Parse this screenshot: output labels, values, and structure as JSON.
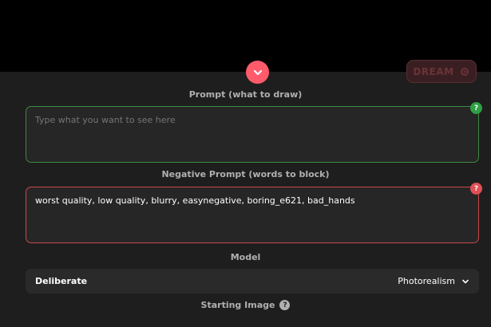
{
  "actions": {
    "dream_label": "DREAM"
  },
  "prompt": {
    "label": "Prompt (what to draw)",
    "placeholder": "Type what you want to see here",
    "value": "",
    "help": "?"
  },
  "negative_prompt": {
    "label": "Negative Prompt (words to block)",
    "value": "worst quality, low quality, blurry, easynegative, boring_e621, bad_hands",
    "help": "?"
  },
  "model": {
    "label": "Model",
    "selected": "Deliberate",
    "category": "Photorealism"
  },
  "starting_image": {
    "label": "Starting Image",
    "help": "?"
  },
  "colors": {
    "accent": "#ff5b6b",
    "prompt_border": "#3e8a3e",
    "negative_border": "#c9484b",
    "panel_bg": "#1e1e1e"
  }
}
